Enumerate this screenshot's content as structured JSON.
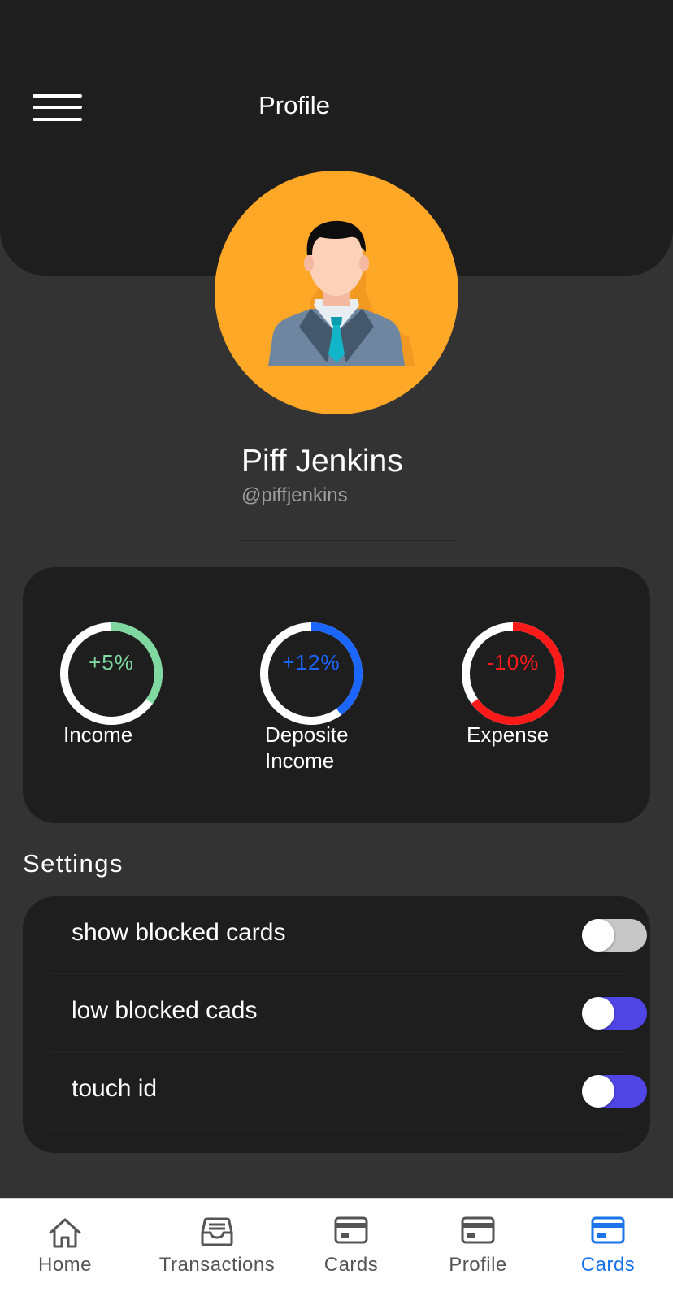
{
  "header": {
    "title": "Profile",
    "menu_icon": "hamburger-menu-icon"
  },
  "profile": {
    "avatar_icon": "businessman-avatar",
    "avatar_bg": "#ffa726",
    "name": "Piff Jenkins",
    "handle": "@piffjenkins"
  },
  "stats": [
    {
      "value": "+5%",
      "label": "Income",
      "color": "#7ed8a0",
      "fill_fraction": 0.35
    },
    {
      "value": "+12%",
      "label": "Deposite Income",
      "label_line1": "Deposite",
      "label_line2": "Income",
      "color": "#1a66ff",
      "fill_fraction": 0.4
    },
    {
      "value": "-10%",
      "label": "Expense",
      "color": "#ff1a1a",
      "fill_fraction": 0.65
    }
  ],
  "settings": {
    "title": "Settings",
    "items": [
      {
        "label": "show blocked cards",
        "enabled": false,
        "track_color": "#c7c7c7"
      },
      {
        "label": "low blocked cads",
        "enabled": true,
        "track_color": "#4f46e5"
      },
      {
        "label": "touch id",
        "enabled": true,
        "track_color": "#4f46e5"
      }
    ]
  },
  "nav": {
    "items": [
      {
        "label": "Home",
        "icon": "home-icon",
        "active": false
      },
      {
        "label": "Transactions",
        "icon": "inbox-icon",
        "active": false
      },
      {
        "label": "Cards",
        "icon": "credit-card-icon",
        "active": false
      },
      {
        "label": "Profile",
        "icon": "credit-card-icon",
        "active": false
      },
      {
        "label": "Cards",
        "icon": "credit-card-icon",
        "active": true
      }
    ],
    "active_color": "#1a73e8",
    "inactive_color": "#555555"
  }
}
